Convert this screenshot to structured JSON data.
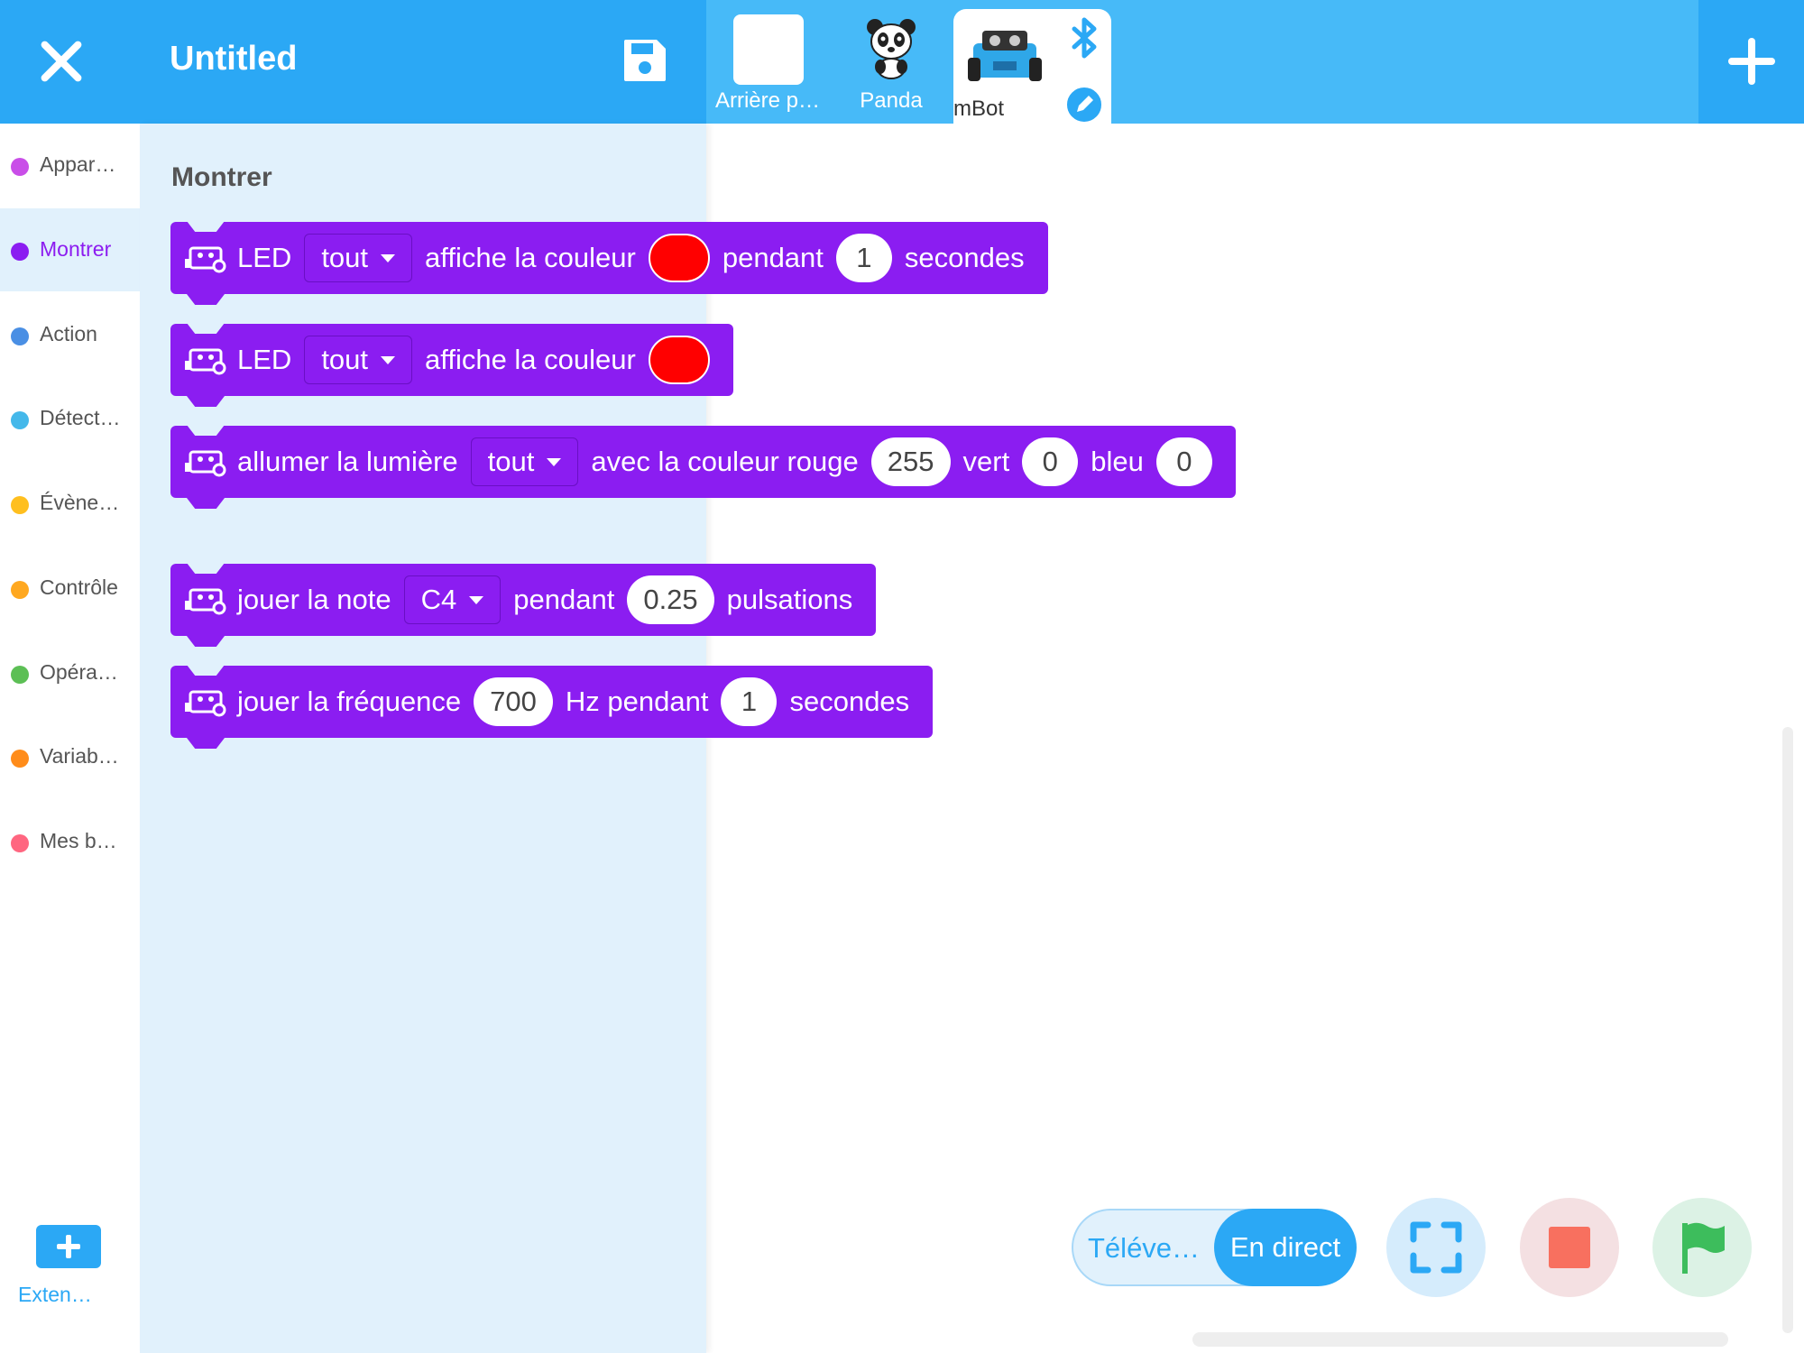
{
  "header": {
    "title": "Untitled",
    "sprites": [
      {
        "label": "Arrière p…"
      },
      {
        "label": "Panda"
      },
      {
        "label": "mBot"
      }
    ]
  },
  "categories": [
    {
      "label": "Appar…",
      "color": "#c94ee8"
    },
    {
      "label": "Montrer",
      "color": "#8b1df1",
      "active": true
    },
    {
      "label": "Action",
      "color": "#4a8fe4"
    },
    {
      "label": "Détect…",
      "color": "#44b8ea"
    },
    {
      "label": "Évène…",
      "color": "#ffbf1f"
    },
    {
      "label": "Contrôle",
      "color": "#ffa820"
    },
    {
      "label": "Opéra…",
      "color": "#5cbf55"
    },
    {
      "label": "Variab…",
      "color": "#ff8c1a"
    },
    {
      "label": "Mes b…",
      "color": "#ff6680"
    }
  ],
  "extensions": {
    "label": "Exten…"
  },
  "palette": {
    "title": "Montrer"
  },
  "blocks": {
    "b1": {
      "led": "LED",
      "target": "tout",
      "shows": "affiche la couleur",
      "during": "pendant",
      "duration": "1",
      "unit": "secondes"
    },
    "b2": {
      "led": "LED",
      "target": "tout",
      "shows": "affiche la couleur"
    },
    "b3": {
      "turn_on": "allumer la lumière",
      "target": "tout",
      "with": "avec la couleur rouge",
      "red": "255",
      "green_label": "vert",
      "green": "0",
      "blue_label": "bleu",
      "blue": "0"
    },
    "b4": {
      "play": "jouer la note",
      "note": "C4",
      "during": "pendant",
      "beats": "0.25",
      "unit": "pulsations"
    },
    "b5": {
      "play": "jouer la fréquence",
      "freq": "700",
      "hz": "Hz pendant",
      "duration": "1",
      "unit": "secondes"
    }
  },
  "controls": {
    "upload": "Téléve…",
    "live": "En direct"
  },
  "colors": {
    "accent": "#2ba8f5",
    "block": "#8b1df1",
    "led_color": "#ff0000"
  }
}
